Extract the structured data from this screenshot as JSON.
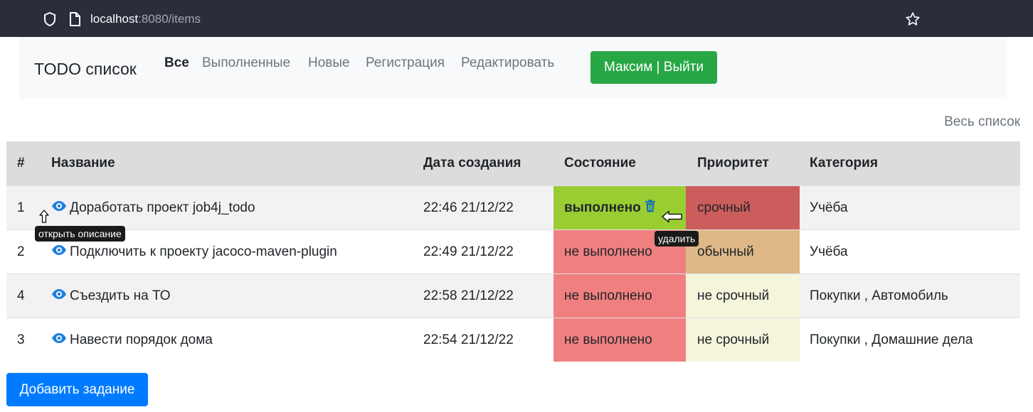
{
  "browser": {
    "url_host": "localhost",
    "url_rest": ":8080/items"
  },
  "navbar": {
    "brand": "TODO список",
    "links": [
      "Все",
      "Выполненные",
      "Новые",
      "Регистрация",
      "Редактировать"
    ],
    "active_link": "Все",
    "user_button": "Максим | Выйти"
  },
  "all_list_link": "Весь список",
  "table": {
    "headers": [
      "#",
      "Название",
      "Дата создания",
      "Состояние",
      "Приоритет",
      "Категория"
    ],
    "rows": [
      {
        "num": "1",
        "name": "Доработать проект job4j_todo",
        "date": "22:46 21/12/22",
        "state": "выполнено",
        "priority": "срочный",
        "category": "Учёба"
      },
      {
        "num": "2",
        "name": "Подключить к проекту jacoco-maven-plugin",
        "date": "22:49 21/12/22",
        "state": "не выполнено",
        "priority": "обычный",
        "category": "Учёба"
      },
      {
        "num": "4",
        "name": "Съездить на ТО",
        "date": "22:58 21/12/22",
        "state": "не выполнено",
        "priority": "не срочный",
        "category": "Покупки , Автомобиль"
      },
      {
        "num": "3",
        "name": "Навести порядок дома",
        "date": "22:54 21/12/22",
        "state": "не выполнено",
        "priority": "не срочный",
        "category": "Покупки , Домашние дела"
      }
    ]
  },
  "tooltips": {
    "open_description": "открыть описание",
    "delete": "удалить"
  },
  "add_button": "Добавить задание",
  "colors": {
    "done": "#9acd32",
    "not_done": "#f08080",
    "urgent": "#cd5c5c",
    "normal": "#deb887",
    "not_urgent": "#f5f5dc",
    "primary": "#007bff",
    "success": "#28a745"
  }
}
